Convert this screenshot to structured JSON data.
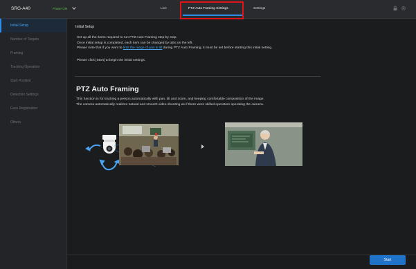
{
  "header": {
    "device_name": "SRG-A40",
    "power_status": "Power ON",
    "tabs": [
      {
        "label": "Live"
      },
      {
        "label": "PTZ Auto Framing Settings"
      },
      {
        "label": "Settings"
      }
    ],
    "icons": [
      "chevron-down-icon",
      "lock-icon",
      "gear-icon"
    ]
  },
  "sidebar": {
    "items": [
      {
        "label": "Initial Setup",
        "active": true
      },
      {
        "label": "Number of Targets"
      },
      {
        "label": "Framing"
      },
      {
        "label": "Tracking Operation"
      },
      {
        "label": "Start Position"
      },
      {
        "label": "Detection Settings"
      },
      {
        "label": "Face Registration"
      },
      {
        "label": "Others"
      }
    ]
  },
  "main": {
    "section_title": "Initial Setup",
    "intro_line1": "Set up all the items required to run PTZ Auto Framing step by step.",
    "intro_line2": "Once initial setup is completed, each item can be changed by tabs on the left.",
    "intro_line3_pre": "Please note that if you want to ",
    "intro_line3_link": "limit the range of pan & tilt",
    "intro_line3_post": " during PTZ Auto Framing, it must be set before starting this initial setting.",
    "click_start": "Please click [Start] to begin the initial settings.",
    "heading": "PTZ Auto Framing",
    "desc_line1": "This function is for tracking a person automatically with pan, tilt and zoom, and keeping comfortable composition of the image.",
    "desc_line2": "The camera automatically realizes natural and smooth video shooting as if there were skilled operators operating the camera.",
    "start_button": "Start"
  },
  "colors": {
    "accent": "#2e8de6",
    "power": "#5cbf4a",
    "highlight": "#e0141b",
    "button": "#1f73c9"
  }
}
